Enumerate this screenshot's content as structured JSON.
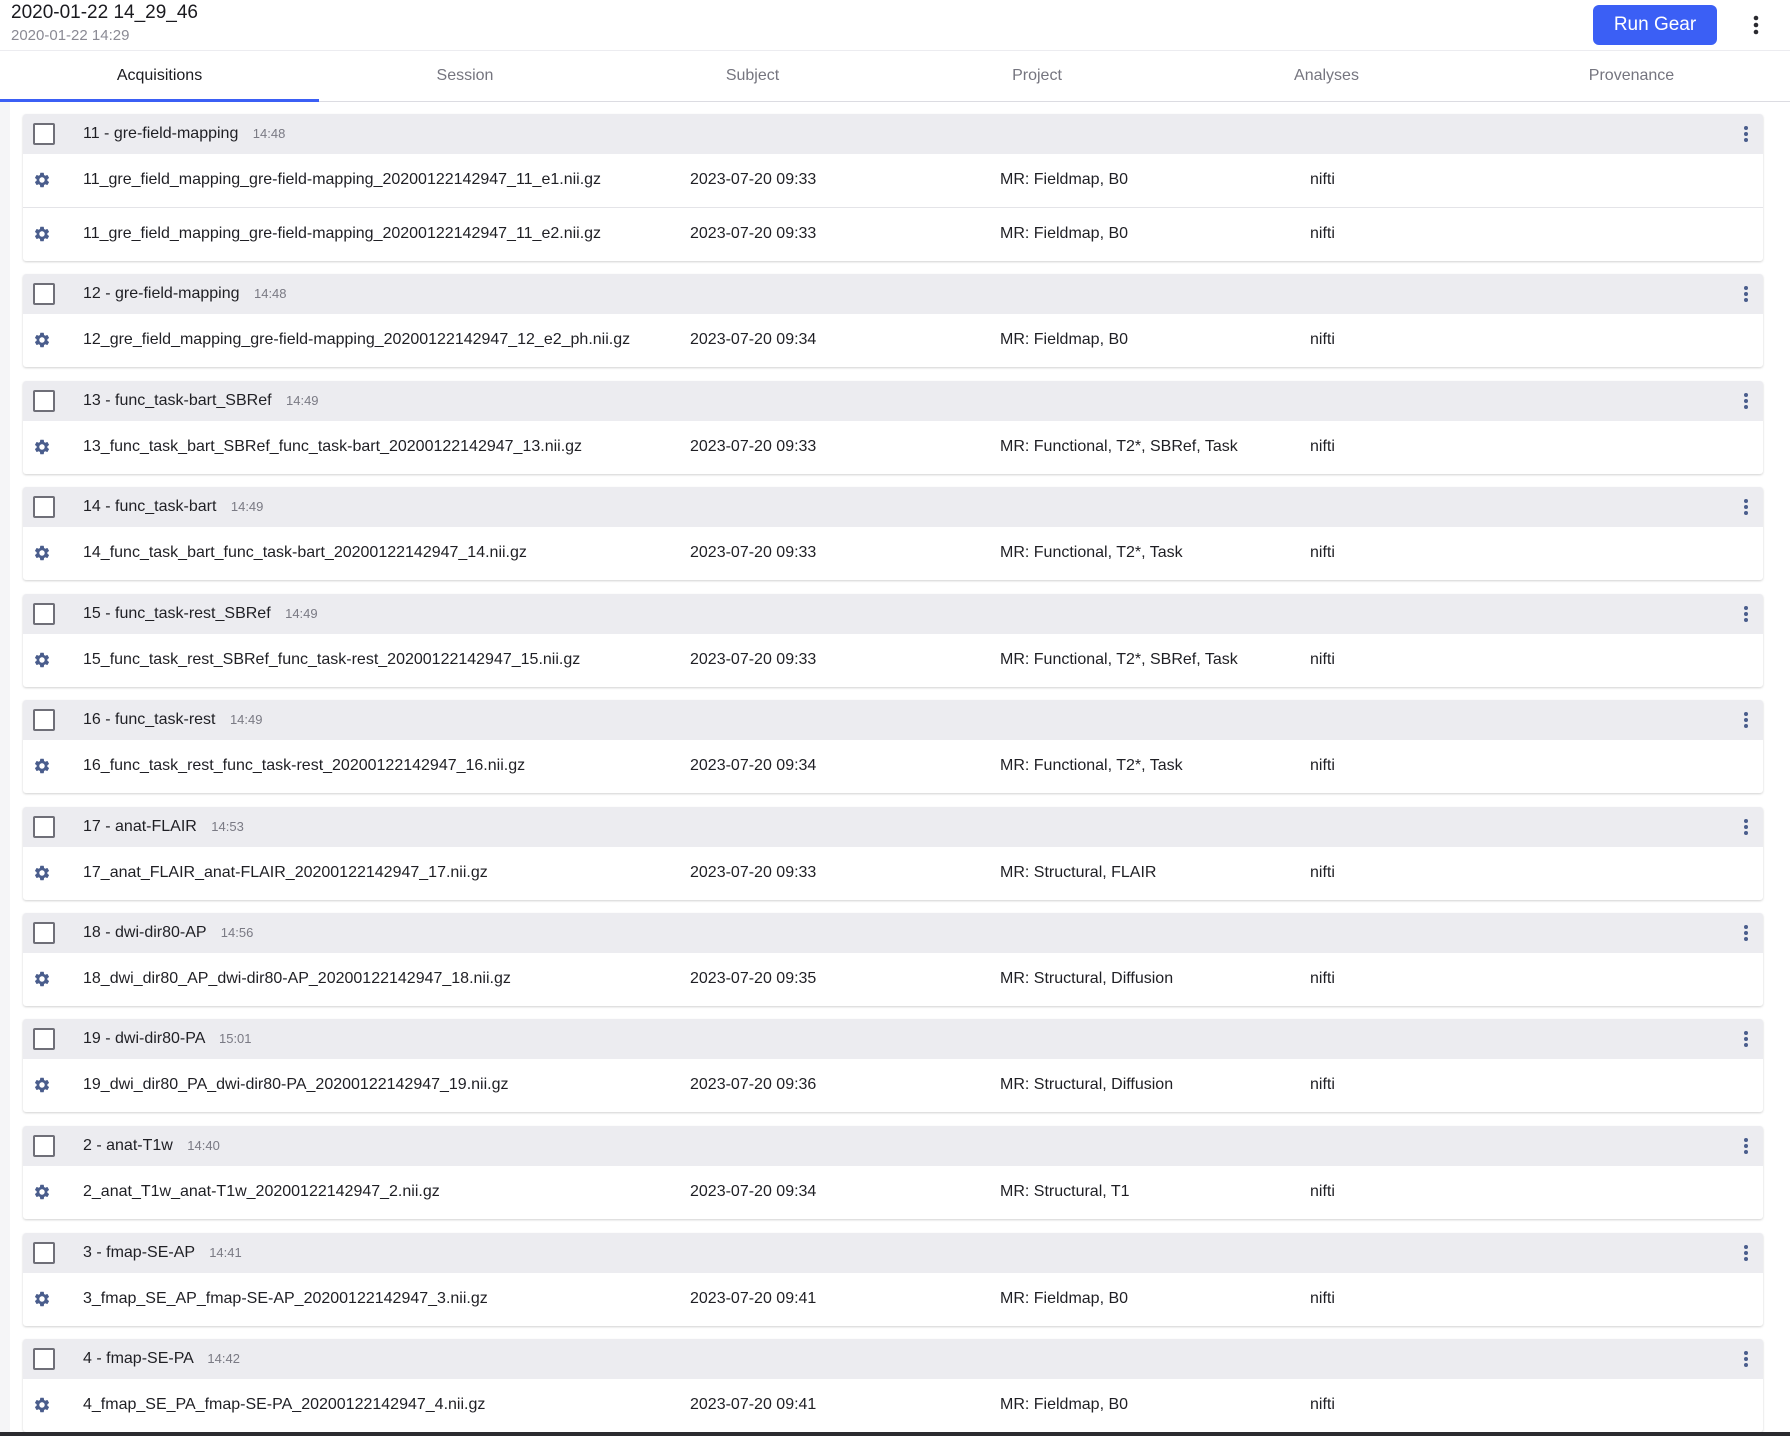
{
  "header": {
    "title": "2020-01-22 14_29_46",
    "subtitle": "2020-01-22 14:29",
    "run_gear_label": "Run Gear",
    "menu_icon": "more-vertical-icon"
  },
  "tabs": [
    {
      "label": "Acquisitions",
      "active": true
    },
    {
      "label": "Session",
      "active": false
    },
    {
      "label": "Subject",
      "active": false
    },
    {
      "label": "Project",
      "active": false
    },
    {
      "label": "Analyses",
      "active": false
    },
    {
      "label": "Provenance",
      "active": false
    }
  ],
  "colors": {
    "accent": "#3b5ff5",
    "group_header_bg": "#ececf0",
    "gear_icon": "#4a5d8c"
  },
  "acquisitions": [
    {
      "name": "11 - gre-field-mapping",
      "time": "14:48",
      "files": [
        {
          "name": "11_gre_field_mapping_gre-field-mapping_20200122142947_11_e1.nii.gz",
          "date": "2023-07-20 09:33",
          "classification": "MR: Fieldmap, B0",
          "type": "nifti"
        },
        {
          "name": "11_gre_field_mapping_gre-field-mapping_20200122142947_11_e2.nii.gz",
          "date": "2023-07-20 09:33",
          "classification": "MR: Fieldmap, B0",
          "type": "nifti"
        }
      ]
    },
    {
      "name": "12 - gre-field-mapping",
      "time": "14:48",
      "files": [
        {
          "name": "12_gre_field_mapping_gre-field-mapping_20200122142947_12_e2_ph.nii.gz",
          "date": "2023-07-20 09:34",
          "classification": "MR: Fieldmap, B0",
          "type": "nifti"
        }
      ]
    },
    {
      "name": "13 - func_task-bart_SBRef",
      "time": "14:49",
      "files": [
        {
          "name": "13_func_task_bart_SBRef_func_task-bart_20200122142947_13.nii.gz",
          "date": "2023-07-20 09:33",
          "classification": "MR: Functional, T2*, SBRef, Task",
          "type": "nifti"
        }
      ]
    },
    {
      "name": "14 - func_task-bart",
      "time": "14:49",
      "files": [
        {
          "name": "14_func_task_bart_func_task-bart_20200122142947_14.nii.gz",
          "date": "2023-07-20 09:33",
          "classification": "MR: Functional, T2*, Task",
          "type": "nifti"
        }
      ]
    },
    {
      "name": "15 - func_task-rest_SBRef",
      "time": "14:49",
      "files": [
        {
          "name": "15_func_task_rest_SBRef_func_task-rest_20200122142947_15.nii.gz",
          "date": "2023-07-20 09:33",
          "classification": "MR: Functional, T2*, SBRef, Task",
          "type": "nifti"
        }
      ]
    },
    {
      "name": "16 - func_task-rest",
      "time": "14:49",
      "files": [
        {
          "name": "16_func_task_rest_func_task-rest_20200122142947_16.nii.gz",
          "date": "2023-07-20 09:34",
          "classification": "MR: Functional, T2*, Task",
          "type": "nifti"
        }
      ]
    },
    {
      "name": "17 - anat-FLAIR",
      "time": "14:53",
      "files": [
        {
          "name": "17_anat_FLAIR_anat-FLAIR_20200122142947_17.nii.gz",
          "date": "2023-07-20 09:33",
          "classification": "MR: Structural, FLAIR",
          "type": "nifti"
        }
      ]
    },
    {
      "name": "18 - dwi-dir80-AP",
      "time": "14:56",
      "files": [
        {
          "name": "18_dwi_dir80_AP_dwi-dir80-AP_20200122142947_18.nii.gz",
          "date": "2023-07-20 09:35",
          "classification": "MR: Structural, Diffusion",
          "type": "nifti"
        }
      ]
    },
    {
      "name": "19 - dwi-dir80-PA",
      "time": "15:01",
      "files": [
        {
          "name": "19_dwi_dir80_PA_dwi-dir80-PA_20200122142947_19.nii.gz",
          "date": "2023-07-20 09:36",
          "classification": "MR: Structural, Diffusion",
          "type": "nifti"
        }
      ]
    },
    {
      "name": "2 - anat-T1w",
      "time": "14:40",
      "files": [
        {
          "name": "2_anat_T1w_anat-T1w_20200122142947_2.nii.gz",
          "date": "2023-07-20 09:34",
          "classification": "MR: Structural, T1",
          "type": "nifti"
        }
      ]
    },
    {
      "name": "3 - fmap-SE-AP",
      "time": "14:41",
      "files": [
        {
          "name": "3_fmap_SE_AP_fmap-SE-AP_20200122142947_3.nii.gz",
          "date": "2023-07-20 09:41",
          "classification": "MR: Fieldmap, B0",
          "type": "nifti"
        }
      ]
    },
    {
      "name": "4 - fmap-SE-PA",
      "time": "14:42",
      "files": [
        {
          "name": "4_fmap_SE_PA_fmap-SE-PA_20200122142947_4.nii.gz",
          "date": "2023-07-20 09:41",
          "classification": "MR: Fieldmap, B0",
          "type": "nifti"
        }
      ]
    }
  ]
}
